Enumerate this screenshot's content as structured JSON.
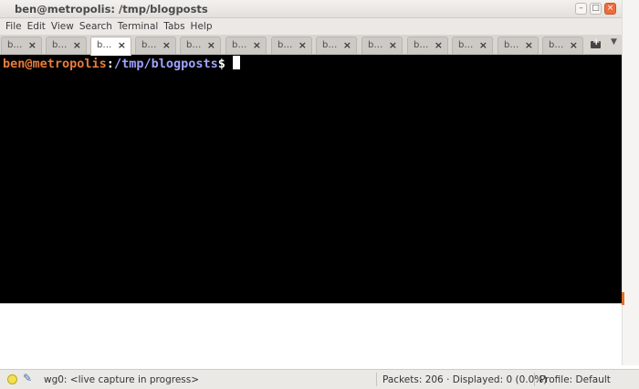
{
  "window": {
    "title": "ben@metropolis: /tmp/blogposts",
    "buttons": {
      "minimize": "–",
      "maximize": "□",
      "close": "×"
    }
  },
  "menu": [
    "File",
    "Edit",
    "View",
    "Search",
    "Terminal",
    "Tabs",
    "Help"
  ],
  "tabs": {
    "labels": [
      "b…",
      "b…",
      "b…",
      "b…",
      "b…",
      "b…",
      "b…",
      "b…",
      "b…",
      "b…",
      "b…",
      "b…",
      "b…"
    ],
    "close_glyph": "×",
    "active_index": 2
  },
  "terminal": {
    "user_host": "ben@metropolis",
    "colon": ":",
    "path": "/tmp/blogposts",
    "dollar": "$"
  },
  "statusbar": {
    "interface": "wg0: <live capture in progress>",
    "packets": "Packets: 206 · Displayed: 0 (0.0%)",
    "profile": "Profile: Default"
  },
  "colors": {
    "prompt_user": "#e97c3a",
    "prompt_path": "#9ea3ff",
    "close_button": "#ea6c3f"
  }
}
